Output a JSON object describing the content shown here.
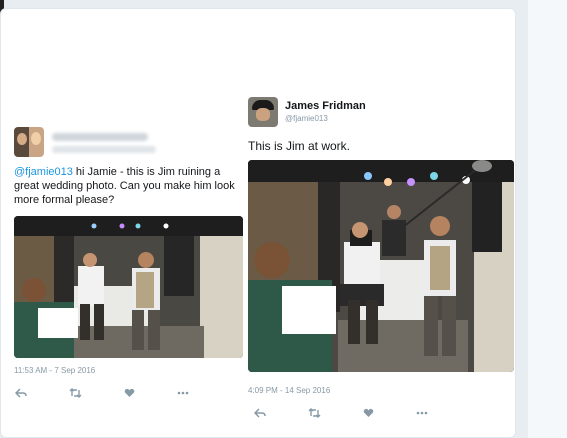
{
  "left_tweet": {
    "handle_mention": "@fjamie013",
    "body": " hi Jamie - this is Jim ruining a great wedding photo. Can you make him look more formal please?",
    "timestamp": "11:53 AM - 7 Sep 2016",
    "photo_alt": "wedding-dance-photo"
  },
  "right_tweet": {
    "display_name": "James Fridman",
    "handle": "@fjamie013",
    "body": "This is Jim at work.",
    "timestamp": "4:09 PM - 14 Sep 2016",
    "photo_alt": "edited-wedding-photo-with-camera-crew"
  },
  "actions": {
    "reply_icon": "reply-icon",
    "retweet_icon": "retweet-icon",
    "like_icon": "heart-icon",
    "more_icon": "more-icon"
  },
  "colors": {
    "link": "#1b95e0",
    "muted": "#8899a6",
    "text": "#14171a"
  }
}
